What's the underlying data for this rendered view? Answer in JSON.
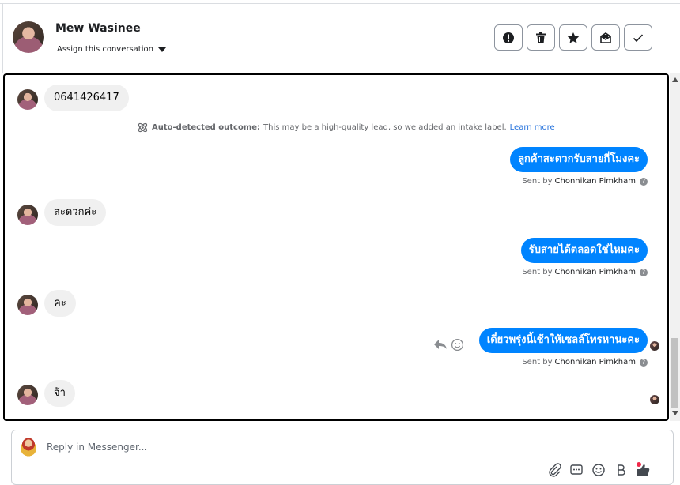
{
  "header": {
    "name": "Mew Wasinee",
    "assign_label": "Assign this conversation",
    "actions": [
      {
        "icon": "alert-icon",
        "name": "mark-spam-button"
      },
      {
        "icon": "trash-icon",
        "name": "delete-button"
      },
      {
        "icon": "star-icon",
        "name": "star-button"
      },
      {
        "icon": "mark-unread-icon",
        "name": "mark-unread-button"
      },
      {
        "icon": "check-icon",
        "name": "mark-done-button"
      }
    ]
  },
  "conversation": {
    "messages": [
      {
        "from": "customer",
        "text": "0641426417"
      },
      {
        "from": "system",
        "label": "Auto-detected outcome:",
        "text": "This may be a high-quality lead, so we added an intake label.",
        "link": "Learn more"
      },
      {
        "from": "page",
        "text": "ลูกค้าสะดวกรับสายกี่โมงคะ",
        "sent_by_prefix": "Sent by",
        "sent_by": "Chonnikan Pimkham"
      },
      {
        "from": "customer",
        "text": "สะดวกค่ะ"
      },
      {
        "from": "page",
        "text": "รับสายได้ตลอดใช่ไหมคะ",
        "sent_by_prefix": "Sent by",
        "sent_by": "Chonnikan Pimkham"
      },
      {
        "from": "customer",
        "text": "คะ"
      },
      {
        "from": "page",
        "text": "เดี๋ยวพรุ่งนี้เช้าให้เซลล์โทรหานะคะ",
        "sent_by_prefix": "Sent by",
        "sent_by": "Chonnikan Pimkham"
      },
      {
        "from": "customer",
        "text": "จ้า"
      }
    ]
  },
  "reply": {
    "placeholder": "Reply in Messenger..."
  },
  "colors": {
    "accent": "#0084ff",
    "incoming_bubble": "#f0f0f0",
    "link": "#216fdb"
  }
}
